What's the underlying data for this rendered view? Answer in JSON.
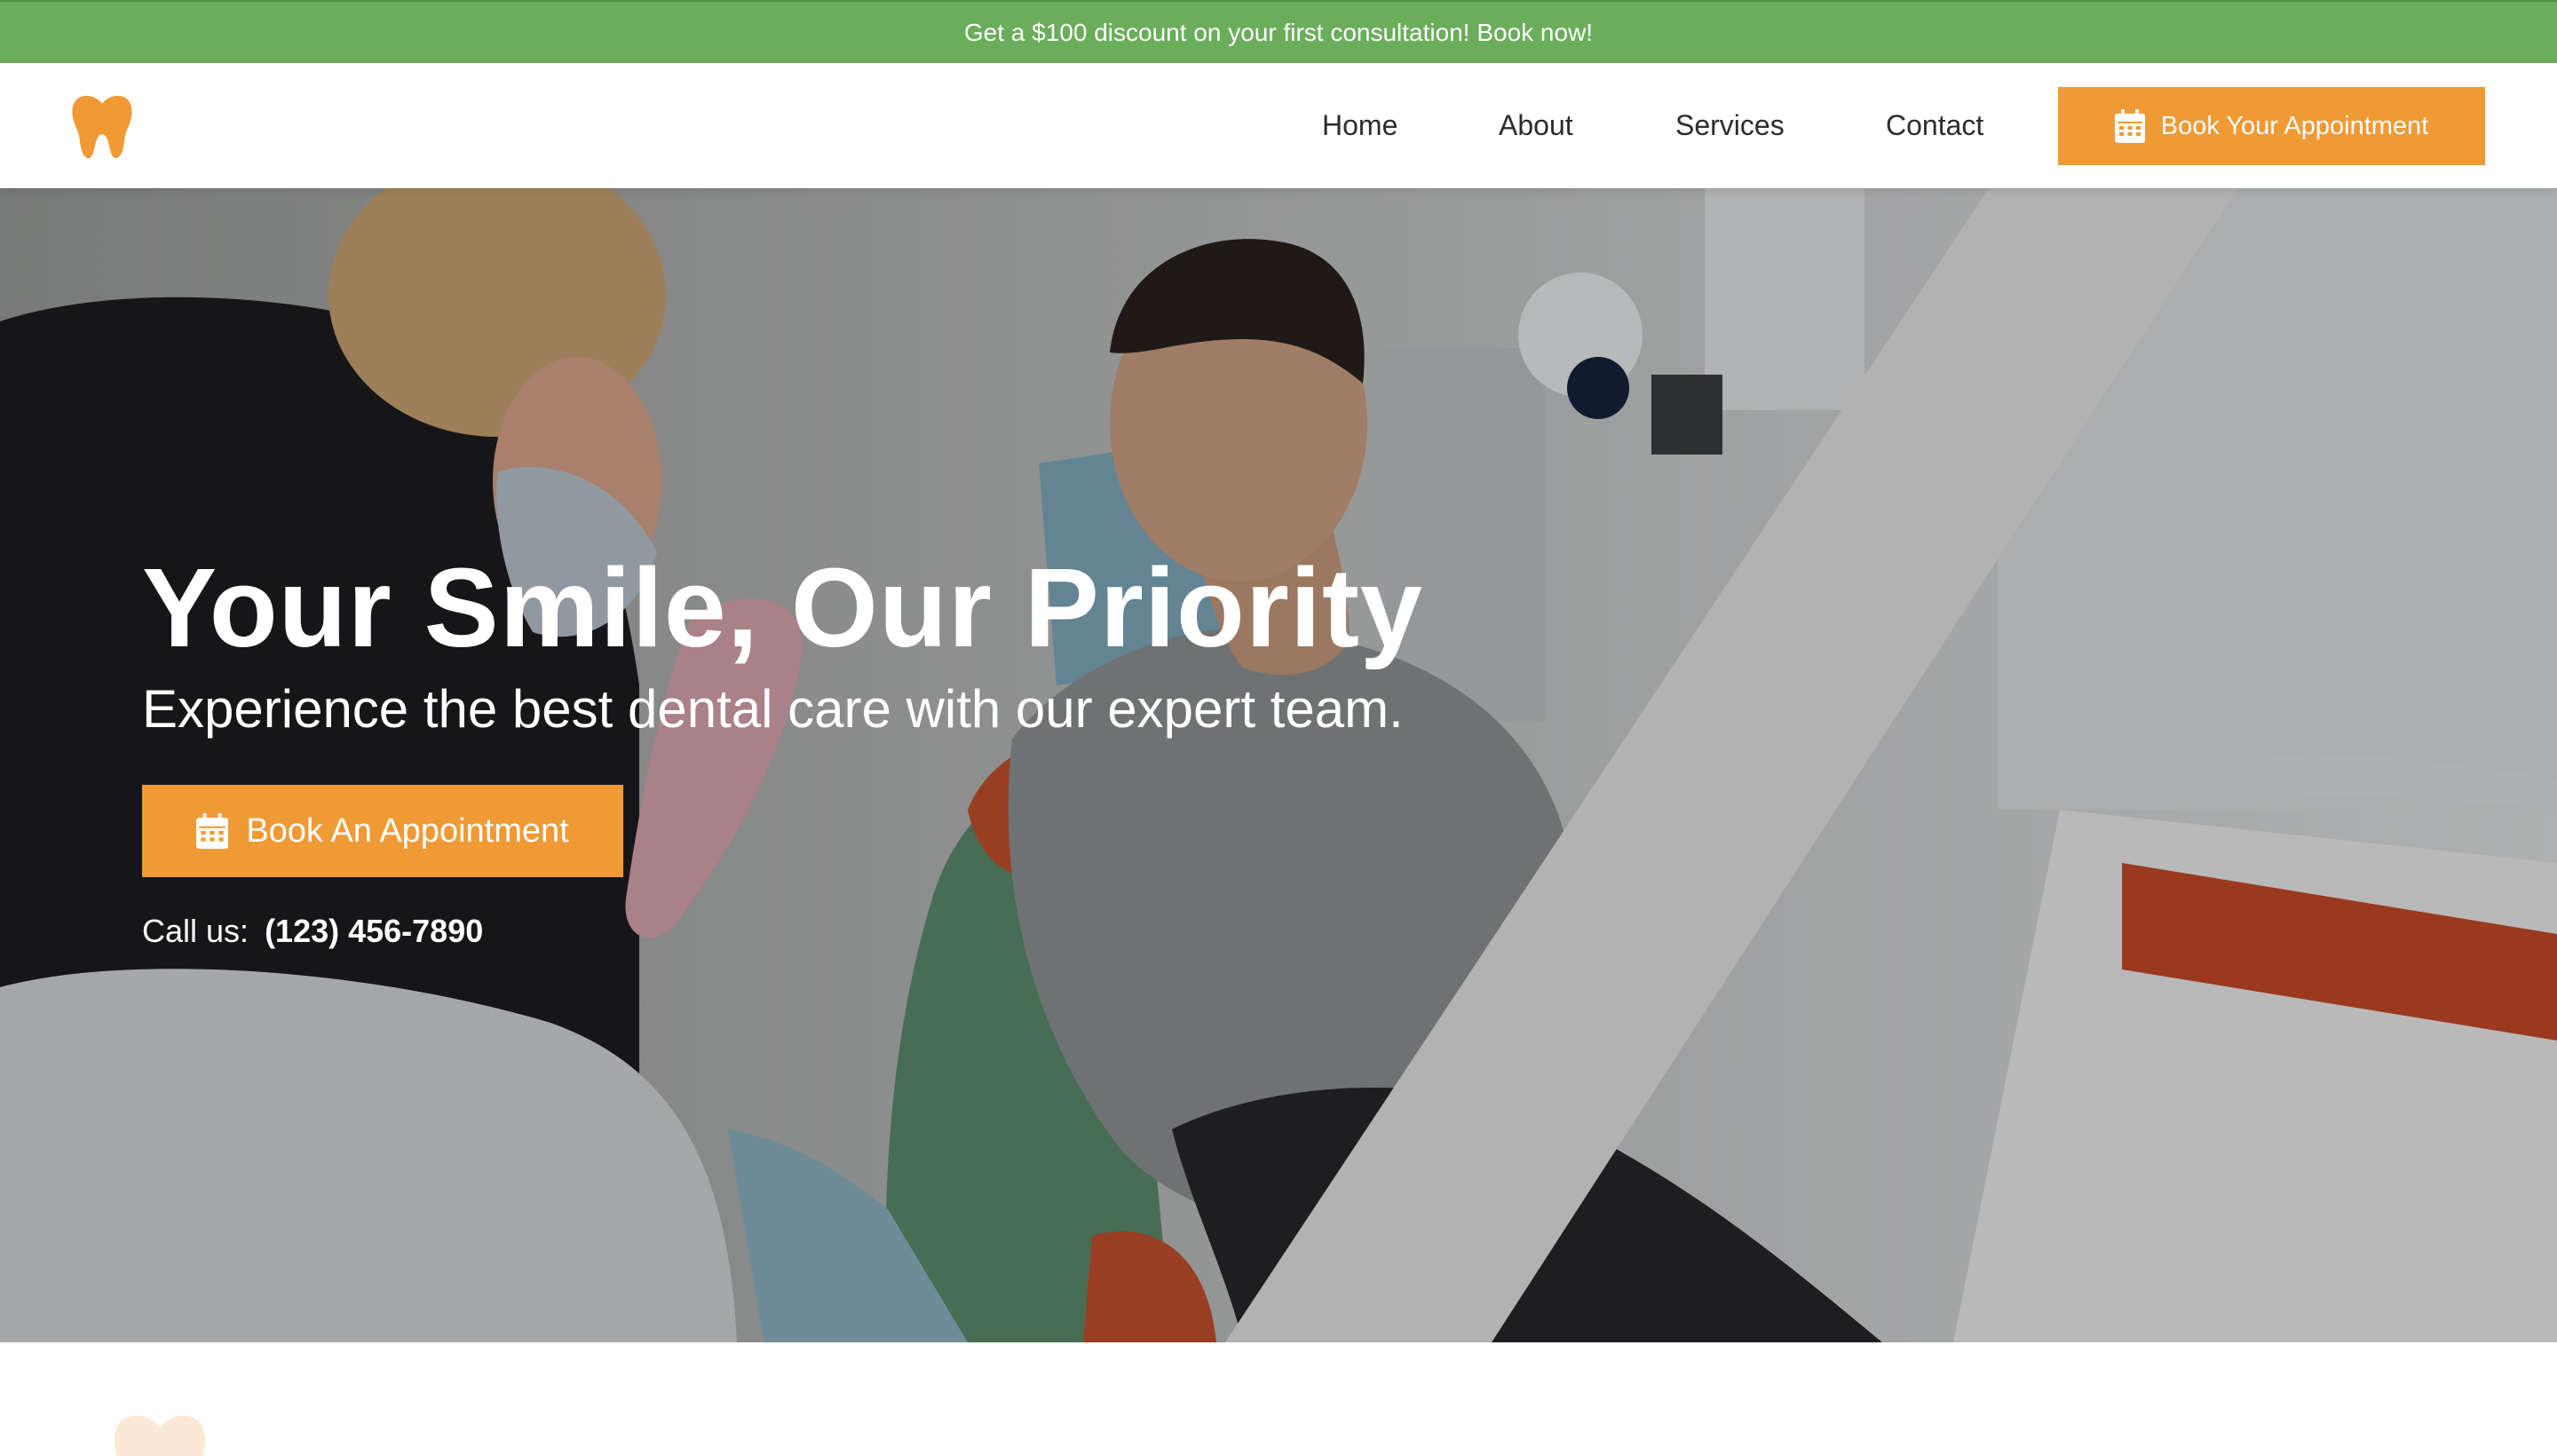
{
  "promo": {
    "text": "Get a $100 discount on your first consultation! Book now!",
    "bg_color": "#6aad5a"
  },
  "nav": {
    "logo_icon": "tooth-icon",
    "items": [
      {
        "label": "Home"
      },
      {
        "label": "About"
      },
      {
        "label": "Services"
      },
      {
        "label": "Contact"
      }
    ],
    "cta": {
      "label": "Book Your Appointment",
      "icon": "calendar-icon"
    }
  },
  "hero": {
    "title": "Your Smile, Our Priority",
    "subtitle": "Experience the best dental care with our expert team.",
    "cta": {
      "label": "Book An Appointment",
      "icon": "calendar-icon"
    },
    "call_prefix": "Call us:",
    "phone": "(123) 456-7890",
    "image_icon": "dental-clinic-photo"
  },
  "colors": {
    "accent": "#f09a36",
    "promo_green": "#6aad5a",
    "text_dark": "#2c2c2c",
    "white": "#ffffff"
  }
}
